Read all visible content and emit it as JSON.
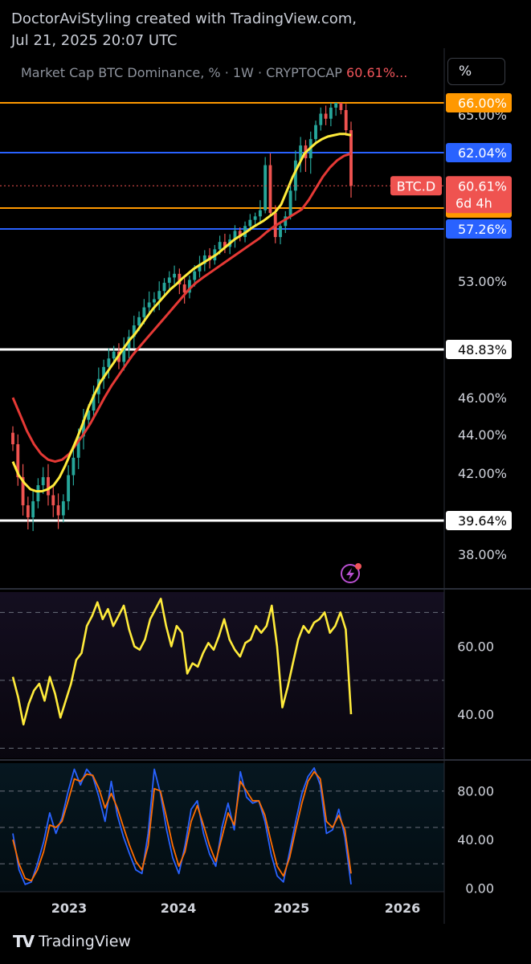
{
  "header": {
    "line1": "DoctorAviStyling created with TradingView.com,",
    "line2": "Jul 21, 2025 20:07 UTC"
  },
  "legend": {
    "symbol": "Market Cap BTC Dominance, % · 1W · CRYPTOCAP",
    "value": "60.61%..."
  },
  "unit_button": "%",
  "footer": {
    "logo": "TV",
    "brand": "TradingView"
  },
  "colors": {
    "background": "#000000",
    "candle_up": "#26a69a",
    "candle_down": "#ef5350",
    "ma_fast": "#ffeb3b",
    "ma_slow": "#e53935",
    "line_orange": "#ff9800",
    "line_blue": "#2962ff",
    "line_white": "#ffffff",
    "rsi": "#ffeb3b",
    "stoch_k": "#2962ff",
    "stoch_d": "#ff6d00"
  },
  "chart_data": [
    {
      "type": "candlestick",
      "title": "Market Cap BTC Dominance, % · 1W · CRYPTOCAP",
      "x_axis_labels": [
        "2023",
        "2024",
        "2025",
        "2026"
      ],
      "y_axis_ticks": [
        "65.00%",
        "53.00%",
        "46.00%",
        "44.00%",
        "42.00%",
        "38.00%"
      ],
      "horizontal_levels": [
        {
          "label": "66.00%",
          "value": 66.0,
          "color": "#ff9800"
        },
        {
          "label": "62.04%",
          "value": 62.04,
          "color": "#2962ff"
        },
        {
          "label": "59.65%",
          "value": 59.65,
          "color": "#ff9800"
        },
        {
          "label": "57.26%",
          "value": 57.26,
          "color": "#2962ff"
        },
        {
          "label": "48.83%",
          "value": 48.83,
          "color": "#ffffff"
        },
        {
          "label": "39.64%",
          "value": 39.64,
          "color": "#ffffff"
        }
      ],
      "price_label": {
        "tag": "BTC.D",
        "value": "60.61%",
        "countdown": "6d 4h",
        "color": "#ef5350"
      },
      "close": [
        43.5,
        41.8,
        40.4,
        39.8,
        40.6,
        41.4,
        41.8,
        40.9,
        40.4,
        39.9,
        40.6,
        41.9,
        42.8,
        43.9,
        44.8,
        45.3,
        46.2,
        47.1,
        47.8,
        48.3,
        48.7,
        48.1,
        48.9,
        49.6,
        50.3,
        50.8,
        51.4,
        51.7,
        51.9,
        52.4,
        52.9,
        53.3,
        53.6,
        52.8,
        52.3,
        53.1,
        53.8,
        54.4,
        55.1,
        54.7,
        55.6,
        56.2,
        55.8,
        56.4,
        57.1,
        56.6,
        57.6,
        58.3,
        58.7,
        59.4,
        61.5,
        59.1,
        56.6,
        57.6,
        58.7,
        60.4,
        61.7,
        62.6,
        61.8,
        63.1,
        64.2,
        65.1,
        64.7,
        65.6,
        66.0,
        65.4,
        63.8,
        60.61
      ],
      "ma_fast": [
        42.6,
        41.9,
        41.5,
        41.2,
        41.1,
        41.1,
        41.2,
        41.4,
        41.8,
        42.4,
        43.1,
        43.8,
        44.6,
        45.5,
        46.2,
        46.9,
        47.4,
        47.9,
        48.4,
        48.9,
        49.4,
        49.8,
        50.3,
        50.8,
        51.3,
        51.7,
        52.1,
        52.5,
        52.8,
        53.2,
        53.6,
        54.0,
        54.3,
        54.6,
        54.9,
        55.2,
        55.6,
        56.0,
        56.4,
        56.7,
        57.0,
        57.4,
        57.8,
        58.2,
        58.7,
        59.2,
        59.8,
        60.4,
        61.0,
        61.5,
        62.0,
        62.4,
        62.8,
        63.1,
        63.3,
        63.4,
        63.5,
        63.5,
        63.4
      ],
      "ma_slow": [
        46.0,
        45.1,
        44.2,
        43.5,
        43.0,
        42.7,
        42.6,
        42.7,
        43.0,
        43.5,
        44.0,
        44.6,
        45.3,
        46.0,
        46.7,
        47.3,
        47.9,
        48.5,
        49.0,
        49.5,
        50.0,
        50.5,
        51.0,
        51.5,
        52.0,
        52.5,
        52.9,
        53.3,
        53.7,
        54.1,
        54.5,
        54.9,
        55.3,
        55.7,
        56.1,
        56.5,
        57.0,
        57.5,
        58.0,
        58.5,
        59.0,
        59.5,
        60.0,
        60.5,
        61.0,
        61.4,
        61.7,
        61.9,
        62.0
      ]
    },
    {
      "type": "line",
      "title": "",
      "y_axis_ticks": [
        "60.00",
        "40.00"
      ],
      "guide_levels": [
        70,
        50,
        30
      ],
      "ylim": [
        27,
        76
      ],
      "series": [
        {
          "values": [
            51,
            45,
            37,
            43,
            47,
            49,
            44,
            51,
            46,
            39,
            44,
            49,
            56,
            58,
            66,
            69,
            73,
            68,
            71,
            66,
            69,
            72,
            65,
            60,
            59,
            62,
            68,
            71,
            74,
            66,
            60,
            66,
            64,
            52,
            55,
            54,
            58,
            61,
            59,
            63,
            68,
            62,
            59,
            57,
            61,
            62,
            66,
            64,
            66,
            72,
            60,
            42,
            48,
            55,
            62,
            66,
            64,
            67,
            68,
            70,
            64,
            66,
            70,
            65,
            40
          ]
        }
      ]
    },
    {
      "type": "line",
      "title": "",
      "y_axis_ticks": [
        "80.00",
        "40.00",
        "0.00"
      ],
      "guide_levels": [
        80,
        50,
        20
      ],
      "ylim": [
        -3,
        103
      ],
      "series": [
        {
          "values": [
            45,
            15,
            3,
            5,
            20,
            38,
            62,
            45,
            58,
            80,
            98,
            85,
            98,
            92,
            75,
            55,
            88,
            60,
            42,
            28,
            15,
            12,
            45,
            98,
            78,
            48,
            25,
            12,
            35,
            65,
            72,
            45,
            28,
            18,
            50,
            70,
            48,
            96,
            75,
            70,
            72,
            55,
            28,
            10,
            5,
            30,
            55,
            78,
            92,
            99,
            85,
            45,
            48,
            65,
            42,
            3
          ]
        },
        {
          "values": [
            40,
            20,
            8,
            6,
            15,
            30,
            52,
            50,
            55,
            72,
            90,
            88,
            94,
            93,
            82,
            66,
            78,
            66,
            50,
            35,
            22,
            15,
            35,
            82,
            80,
            58,
            35,
            18,
            30,
            55,
            68,
            52,
            35,
            22,
            42,
            62,
            52,
            88,
            80,
            72,
            72,
            60,
            38,
            18,
            10,
            25,
            48,
            70,
            88,
            96,
            90,
            55,
            50,
            60,
            48,
            12
          ]
        }
      ]
    }
  ]
}
